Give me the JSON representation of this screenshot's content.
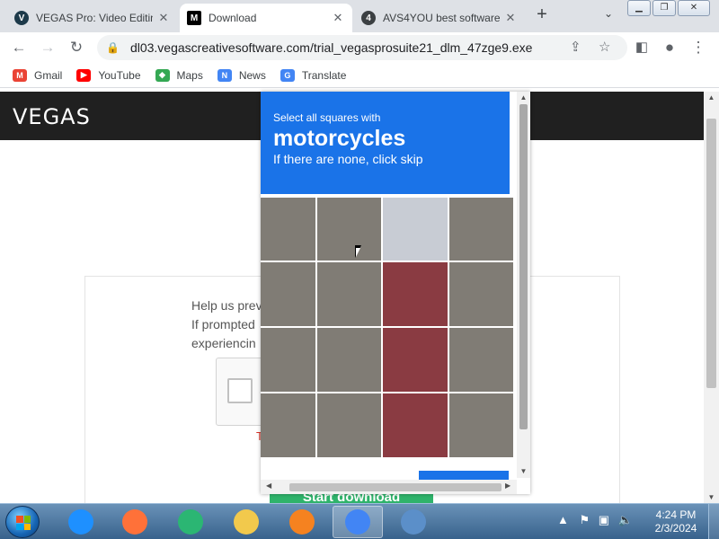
{
  "browser": {
    "tabs": [
      {
        "title": "VEGAS Pro: Video Editing",
        "favicon": "V",
        "favicon_color": "#1d3a4a",
        "active": false
      },
      {
        "title": "Download",
        "favicon": "M",
        "favicon_color": "#000000",
        "active": true
      },
      {
        "title": "AVS4YOU best software",
        "favicon": "4",
        "favicon_color": "#3c4043",
        "active": false
      }
    ],
    "new_tab_icon": "+",
    "tab_search_icon": "chevron-down-icon",
    "address": "dl03.vegascreativesoftware.com/trial_vegasprosuite21_dlm_47zge9.exe",
    "bookmarks": [
      {
        "label": "Gmail",
        "icon": "gmail-icon",
        "color": "#ea4335",
        "glyph": "M"
      },
      {
        "label": "YouTube",
        "icon": "youtube-icon",
        "color": "#ff0000",
        "glyph": "▶"
      },
      {
        "label": "Maps",
        "icon": "maps-icon",
        "color": "#34a853",
        "glyph": "◆"
      },
      {
        "label": "News",
        "icon": "news-icon",
        "color": "#4285f4",
        "glyph": "N"
      },
      {
        "label": "Translate",
        "icon": "translate-icon",
        "color": "#4285f4",
        "glyph": "G"
      }
    ]
  },
  "page": {
    "logo": "VEGAS",
    "help_lines": [
      "Help us prev",
      "If prompted",
      "experiencin"
    ],
    "red_fragment": "T",
    "start_button": "Start download"
  },
  "captcha": {
    "instruction": "Select all squares with",
    "target": "motorcycles",
    "subtitle": "If there are none, click skip",
    "tiles": [
      [
        "road",
        "road",
        "rider",
        "road"
      ],
      [
        "road",
        "road",
        "bike",
        "road"
      ],
      [
        "road",
        "road",
        "bike",
        "road"
      ],
      [
        "road",
        "road",
        "bike",
        "road"
      ]
    ]
  },
  "taskbar": {
    "apps": [
      {
        "name": "internet-explorer-icon",
        "color": "#1e90ff"
      },
      {
        "name": "firefox-icon",
        "color": "#ff7139"
      },
      {
        "name": "edge-icon",
        "color": "#2bb673"
      },
      {
        "name": "file-explorer-icon",
        "color": "#f2c94c"
      },
      {
        "name": "media-player-icon",
        "color": "#f58220"
      },
      {
        "name": "chrome-icon",
        "color": "#4285f4"
      },
      {
        "name": "remote-desktop-icon",
        "color": "#5b8fc9"
      }
    ],
    "time": "4:24 PM",
    "date": "2/3/2024"
  }
}
